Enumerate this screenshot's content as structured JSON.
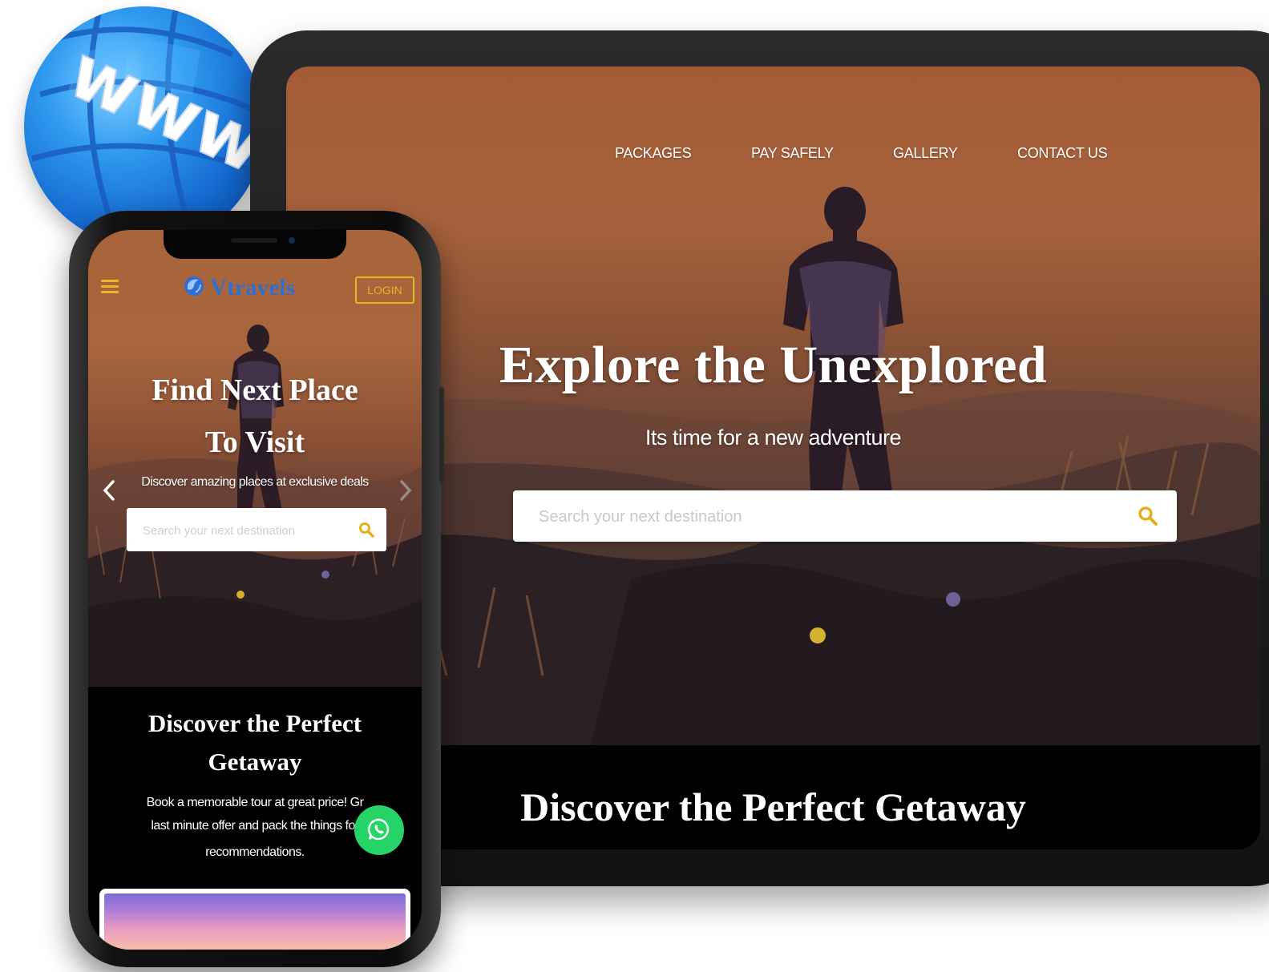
{
  "globe": {
    "text": "www"
  },
  "desktop": {
    "nav": [
      {
        "label": "PACKAGES"
      },
      {
        "label": "PAY SAFELY"
      },
      {
        "label": "GALLERY"
      },
      {
        "label": "CONTACT US"
      }
    ],
    "hero": {
      "title": "Explore the Unexplored",
      "subtitle": "Its time for a new adventure",
      "search_placeholder": "Search your next destination"
    },
    "section_title": "Discover the Perfect Getaway"
  },
  "mobile": {
    "logo": "Vtravels",
    "login_label": "LOGIN",
    "hero": {
      "title_line1": "Find Next Place",
      "title_line2": "To Visit",
      "subtitle": "Discover amazing places at exclusive deals",
      "search_placeholder": "Search your next destination"
    },
    "section": {
      "title_line1": "Discover the Perfect",
      "title_line2": "Getaway",
      "text_line1": "Book a memorable tour at great price! Gr",
      "text_line2": "last minute offer and pack the things for",
      "text_line3": "recommendations."
    }
  },
  "colors": {
    "accent_yellow": "#e7b422",
    "logo_blue": "#2d6fd3",
    "whatsapp_green": "#25d366"
  },
  "icons": [
    "globe-icon",
    "search-icon",
    "menu-icon",
    "logo-icon",
    "chevron-left-icon",
    "chevron-right-icon",
    "whatsapp-icon"
  ]
}
